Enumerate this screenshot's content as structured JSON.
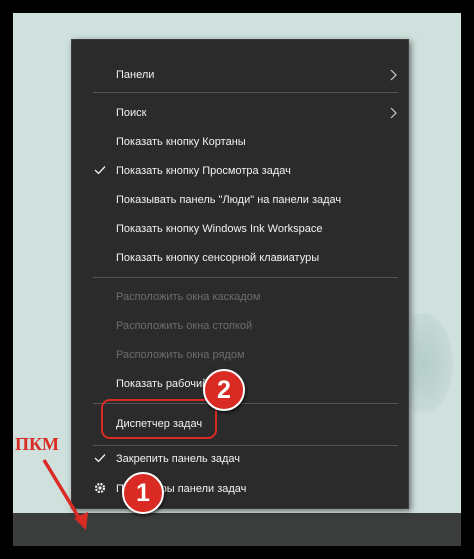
{
  "menu": {
    "items": [
      {
        "label": "Панели",
        "checked": false,
        "submenu": true,
        "disabled": false
      },
      {
        "label": "Поиск",
        "checked": false,
        "submenu": true,
        "disabled": false
      },
      {
        "label": "Показать кнопку Кортаны",
        "checked": false,
        "submenu": false,
        "disabled": false
      },
      {
        "label": "Показать кнопку Просмотра задач",
        "checked": true,
        "submenu": false,
        "disabled": false
      },
      {
        "label": "Показывать панель \"Люди\" на панели задач",
        "checked": false,
        "submenu": false,
        "disabled": false
      },
      {
        "label": "Показать кнопку Windows Ink Workspace",
        "checked": false,
        "submenu": false,
        "disabled": false
      },
      {
        "label": "Показать кнопку сенсорной клавиатуры",
        "checked": false,
        "submenu": false,
        "disabled": false
      },
      {
        "label": "Расположить окна каскадом",
        "checked": false,
        "submenu": false,
        "disabled": true
      },
      {
        "label": "Расположить окна стопкой",
        "checked": false,
        "submenu": false,
        "disabled": true
      },
      {
        "label": "Расположить окна рядом",
        "checked": false,
        "submenu": false,
        "disabled": true
      },
      {
        "label": "Показать рабочий",
        "checked": false,
        "submenu": false,
        "disabled": false
      },
      {
        "label": "Диспетчер задач",
        "checked": false,
        "submenu": false,
        "disabled": false
      },
      {
        "label": "Закрепить панель задач",
        "checked": true,
        "submenu": false,
        "disabled": false
      },
      {
        "label": "Параметры панели задач",
        "checked": false,
        "submenu": false,
        "disabled": false
      }
    ]
  },
  "annotations": {
    "badge_1": "1",
    "badge_2": "2",
    "pkm_label": "ПКМ"
  },
  "colors": {
    "menu_bg": "#2b2b2b",
    "accent_red": "#d92b24",
    "desktop": "#cfe0dd",
    "taskbar": "#3a3d3b"
  }
}
